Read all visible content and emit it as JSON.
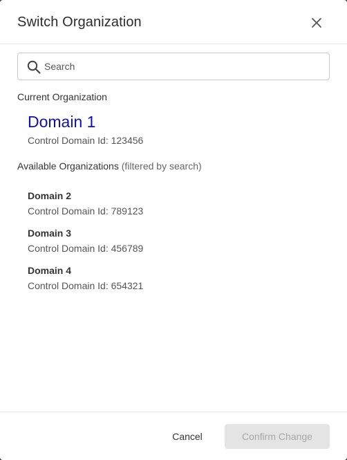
{
  "dialog": {
    "title": "Switch Organization"
  },
  "search": {
    "placeholder": "Search",
    "value": ""
  },
  "current": {
    "label": "Current Organization",
    "name": "Domain 1",
    "id_text": "Control Domain Id: 123456"
  },
  "available": {
    "label": "Available Organizations",
    "note": "(filtered by search)",
    "items": [
      {
        "name": "Domain 2",
        "id_text": "Control Domain Id: 789123"
      },
      {
        "name": "Domain 3",
        "id_text": "Control Domain Id: 456789"
      },
      {
        "name": "Domain 4",
        "id_text": "Control Domain Id: 654321"
      }
    ]
  },
  "footer": {
    "cancel_label": "Cancel",
    "confirm_label": "Confirm Change",
    "confirm_enabled": false
  },
  "icons": {
    "close": "close-icon",
    "search": "search-icon"
  },
  "colors": {
    "current_name": "#0f12a6",
    "confirm_disabled_bg": "#e4e4e4",
    "confirm_disabled_text": "#a8a8a8"
  }
}
